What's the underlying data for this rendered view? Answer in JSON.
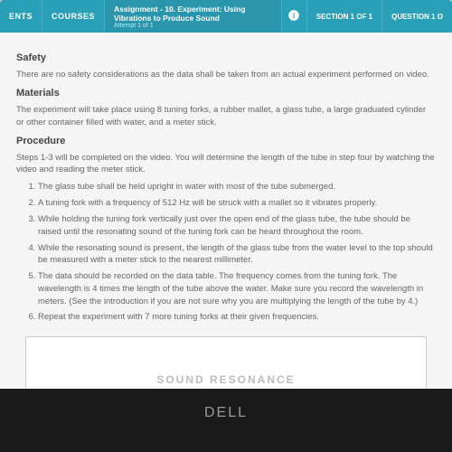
{
  "topbar": {
    "nav0": "ENTS",
    "nav1": "COURSES",
    "assign_title": "Assignment - 10. Experiment: Using Vibrations to Produce Sound",
    "assign_sub": "Attempt 1 of 1",
    "section": "SECTION 1 of 1",
    "question": "QUESTION 1 o"
  },
  "safety": {
    "heading": "Safety",
    "body": "There are no safety considerations as the data shall be taken from an actual experiment performed on video."
  },
  "materials": {
    "heading": "Materials",
    "body": "The experiment will take place using 8 tuning forks, a rubber mallet, a glass tube, a large graduated cylinder or other container filled with water, and a meter stick."
  },
  "procedure": {
    "heading": "Procedure",
    "intro": "Steps 1-3 will be completed on the video. You will determine the length of the tube in step four by watching the video and reading the meter stick.",
    "steps": {
      "s1": "The glass tube shall be held upright in water with most of the tube submerged.",
      "s2": "A tuning fork with a frequency of 512 Hz will be struck with a mallet so it vibrates properly.",
      "s3": "While holding the tuning fork vertically just over the open end of the glass tube, the tube should be raised until the resonating sound of the tuning fork can be heard throughout the room.",
      "s4": "While the resonating sound is present, the length of the glass tube from the water level to the top should be measured with a meter stick to the nearest millimeter.",
      "s5": "The data should be recorded on the data table. The frequency comes from the tuning fork. The wavelength is 4 times the length of the tube above the water. Make sure you record the wavelength in meters. (See the introduction if you are not sure why you are multiplying the length of the tube by 4.)",
      "s6": "Repeat the experiment with 7 more tuning forks at their given frequencies."
    }
  },
  "table": {
    "title": "SOUND RESONANCE"
  },
  "device": {
    "brand": "DELL"
  }
}
